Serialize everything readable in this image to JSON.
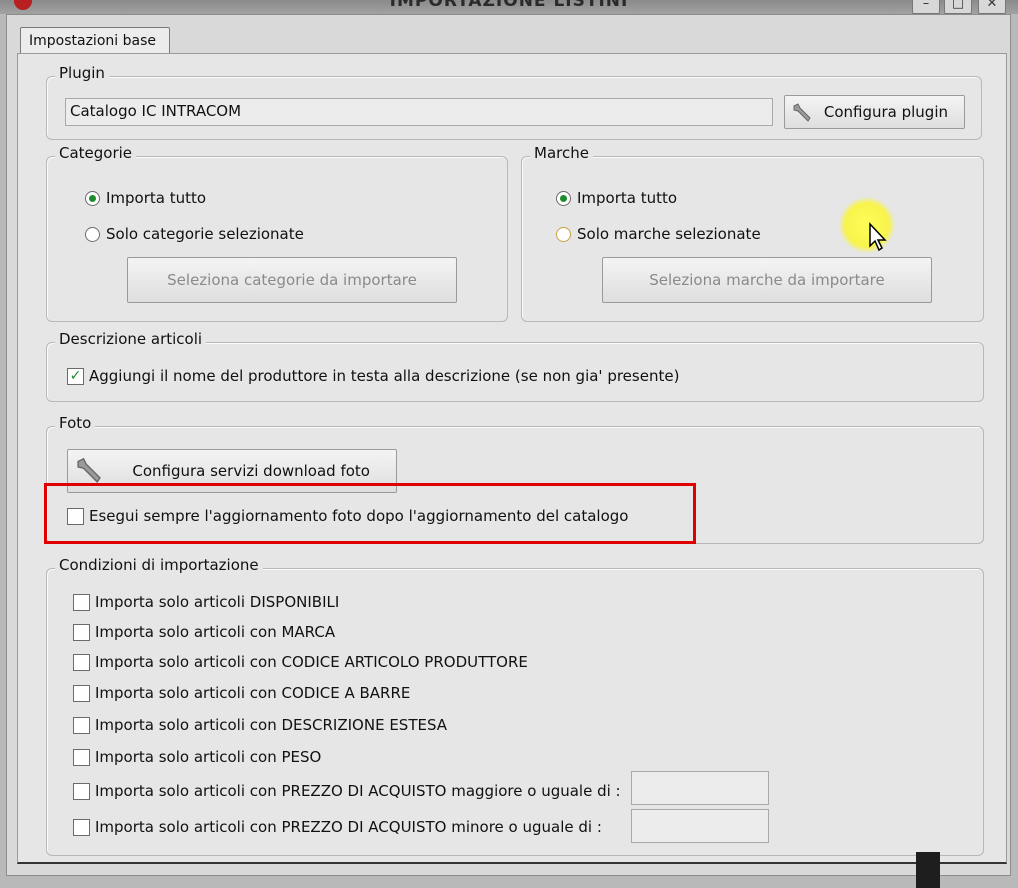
{
  "window": {
    "title": "IMPORTAZIONE LISTINI"
  },
  "tabs": [
    {
      "label": "Impostazioni base"
    }
  ],
  "plugin": {
    "legend": "Plugin",
    "value": "Catalogo IC INTRACOM",
    "config_button": "Configura plugin"
  },
  "categorie": {
    "legend": "Categorie",
    "options": [
      {
        "label": "Importa tutto",
        "selected": true
      },
      {
        "label": "Solo categorie selezionate",
        "selected": false
      }
    ],
    "select_button": "Seleziona categorie da importare"
  },
  "marche": {
    "legend": "Marche",
    "options": [
      {
        "label": "Importa tutto",
        "selected": true
      },
      {
        "label": "Solo marche selezionate",
        "selected": false
      }
    ],
    "select_button": "Seleziona marche da importare"
  },
  "descrizione": {
    "legend": "Descrizione articoli",
    "checkbox_label": "Aggiungi il nome del produttore in testa alla descrizione (se non gia' presente)",
    "checked": true
  },
  "foto": {
    "legend": "Foto",
    "config_button": "Configura servizi download foto",
    "checkbox_label": "Esegui sempre l'aggiornamento foto dopo l'aggiornamento del catalogo",
    "checked": false
  },
  "condizioni": {
    "legend": "Condizioni di importazione",
    "items": [
      {
        "label": "Importa solo articoli DISPONIBILI",
        "checked": false
      },
      {
        "label": "Importa solo articoli con MARCA",
        "checked": false
      },
      {
        "label": "Importa solo articoli con CODICE ARTICOLO PRODUTTORE",
        "checked": false
      },
      {
        "label": "Importa solo articoli con CODICE A BARRE",
        "checked": false
      },
      {
        "label": "Importa solo articoli con DESCRIZIONE ESTESA",
        "checked": false
      },
      {
        "label": "Importa solo articoli con PESO",
        "checked": false
      },
      {
        "label": "Importa solo articoli con PREZZO DI ACQUISTO maggiore o uguale di :",
        "checked": false,
        "input_value": ""
      },
      {
        "label": "Importa solo articoli con PREZZO DI ACQUISTO minore o uguale di :",
        "checked": false,
        "input_value": ""
      }
    ]
  },
  "colors": {
    "accent_check": "#1c8c2c",
    "highlight": "#e00000"
  }
}
